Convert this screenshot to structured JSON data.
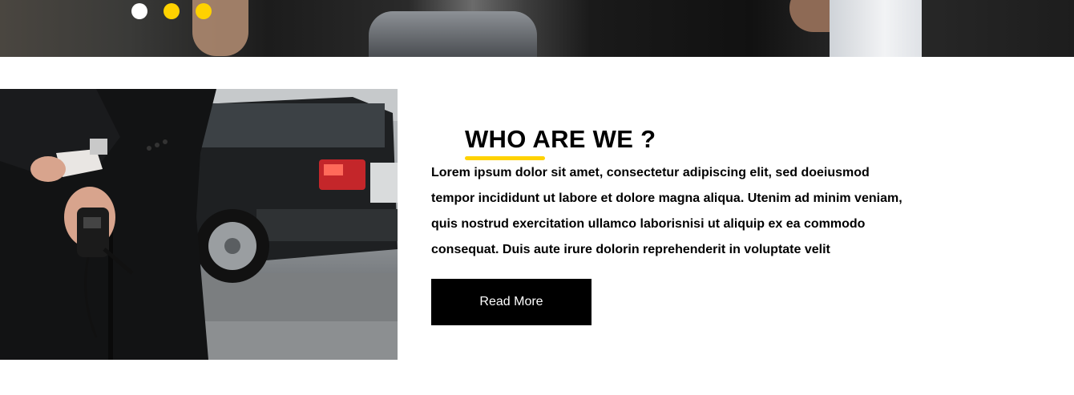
{
  "hero": {
    "slider_dots": [
      {
        "state": "active",
        "color": "#ffffff"
      },
      {
        "state": "inactive",
        "color": "#ffd200"
      },
      {
        "state": "inactive",
        "color": "#ffd200"
      }
    ]
  },
  "about": {
    "heading": "WHO ARE WE ?",
    "accent_color": "#ffd200",
    "body": "Lorem ipsum dolor sit amet, consectetur adipiscing elit, sed doeiusmod tempor incididunt ut labore et dolore magna aliqua. Utenim ad minim veniam, quis nostrud exercitation ullamco laborisnisi ut aliquip ex ea commodo consequat. Duis aute irure dolorin reprehenderit in voluptate velit",
    "button_label": "Read More",
    "photo_icon": "security-guard-photo"
  }
}
